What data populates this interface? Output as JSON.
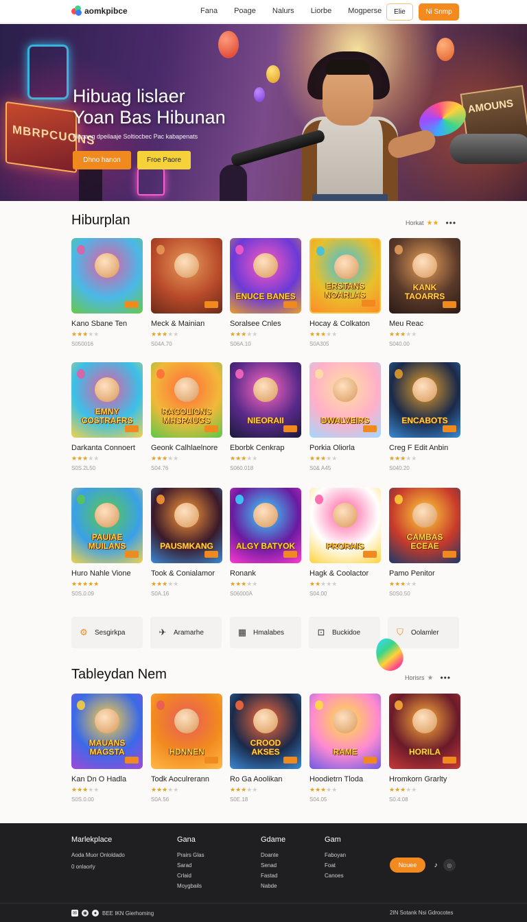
{
  "header": {
    "logo_text": "aomkpibce",
    "nav": [
      "Fana",
      "Poage",
      "Nalurs",
      "Liorbe",
      "Mogperse"
    ],
    "outline_button": "Elie",
    "primary_button": "Ni Snmp"
  },
  "hero": {
    "title_line1": "Hibuag lislaer",
    "title_line2": "Yoan Bas Hibunan",
    "subtitle": "Fiopang dpeilaaje Soltiocbec Pac kabapenats",
    "button1": "Dhno hanon",
    "button2": "Froe Paore",
    "sign_left": "MBRPCUONS",
    "sign_right": "AMOUNS"
  },
  "section1": {
    "title": "Hiburplan",
    "meta_label": "Horkat",
    "cards": [
      {
        "name": "Kano Sbane Ten",
        "stars": 3,
        "price": "S050016",
        "label": ""
      },
      {
        "name": "Meck & Mainian",
        "stars": 3,
        "price": "S04A.70",
        "label": ""
      },
      {
        "name": "Soralsee Cnles",
        "stars": 3,
        "price": "S06A.10",
        "label": "ENUCE BANES"
      },
      {
        "name": "Hocay & Colkaton",
        "stars": 3,
        "price": "S0A305",
        "label": "ERSTANS NOARLAS"
      },
      {
        "name": "Meu Reac",
        "stars": 3,
        "price": "S040.00",
        "label": "KANK TAOARRS"
      },
      {
        "name": "Darkanta Connoert",
        "stars": 3,
        "price": "S0S.2L50",
        "label": "EMNY COSTRAFRS"
      },
      {
        "name": "Geonk Calhlaelnore",
        "stars": 3,
        "price": "S04.76",
        "label": "RACOLIONS MHSPAUGS"
      },
      {
        "name": "Eborbk Cenkrap",
        "stars": 3,
        "price": "S060.018",
        "label": "NIEORAII"
      },
      {
        "name": "Porkia Oliorla",
        "stars": 3,
        "price": "S0& A45",
        "label": "DWALVEIRS"
      },
      {
        "name": "Creg F Edit Anbin",
        "stars": 3,
        "price": "S040.20",
        "label": "ENCABOTS"
      },
      {
        "name": "Huro Nahle Vione",
        "stars": 5,
        "price": "S0S.0.09",
        "label": "PAUIAE MUILANS"
      },
      {
        "name": "Took & Conialamor",
        "stars": 3,
        "price": "S0A.16",
        "label": "PAUSMKANG"
      },
      {
        "name": "Ronank",
        "stars": 3,
        "price": "S06000A",
        "label": "ALGY BATYOK"
      },
      {
        "name": "Hagk & Coolactor",
        "stars": 2,
        "price": "S04.00",
        "label": "PRORAIS"
      },
      {
        "name": "Pamo Penitor",
        "stars": 3,
        "price": "S0S0.50",
        "label": "CAMBAS ECEAE"
      }
    ]
  },
  "categories": [
    {
      "label": "Sesgirkpa",
      "icon": "gear-icon"
    },
    {
      "label": "Aramarhe",
      "icon": "plane-icon"
    },
    {
      "label": "Hmalabes",
      "icon": "grid-icon"
    },
    {
      "label": "Buckidoe",
      "icon": "box-icon"
    },
    {
      "label": "Oolamler",
      "icon": "shield-icon"
    }
  ],
  "section2": {
    "title": "Tableydan Nem",
    "meta_label": "Horisrs",
    "cards": [
      {
        "name": "Kan Dn O Hadla",
        "stars": 3,
        "price": "S0S.0.00",
        "label": "MAUANS MAGSTA"
      },
      {
        "name": "Todk Aoculrerann",
        "stars": 3,
        "price": "S0A.56",
        "label": "HDNNEN"
      },
      {
        "name": "Ro Ga Aoolikan",
        "stars": 3,
        "price": "S0E.18",
        "label": "CROOD AKSES"
      },
      {
        "name": "Hoodietrn Tloda",
        "stars": 3,
        "price": "S04.05",
        "label": "RAME"
      },
      {
        "name": "Hromkorn Grarlty",
        "stars": 3,
        "price": "S0.4.08",
        "label": "HORILA"
      }
    ]
  },
  "footer": {
    "col1_title": "Marlekplace",
    "col1_items": [
      "Aoda Muor Onloldado",
      "0 onlaorly"
    ],
    "col2_title": "Gana",
    "col2_items": [
      "Prairs Glas",
      "Sarad",
      "Crlaid",
      "Moygbails"
    ],
    "col3_title": "Gdame",
    "col3_items": [
      "Doante",
      "Senad",
      "Fastad",
      "Nabde"
    ],
    "col4_title": "Gam",
    "col4_items": [
      "Faboyan",
      "Foat",
      "Canoes"
    ],
    "button": "Nouee",
    "bottom_left": "BEE IKN Gierhoming",
    "bottom_right": "2IN Sotank Nsi Gdrocotes"
  },
  "colors": {
    "accent": "#f28a1f",
    "accent_yellow": "#f6d23a",
    "star": "#e8a020",
    "footer_bg": "#1f1f22"
  }
}
